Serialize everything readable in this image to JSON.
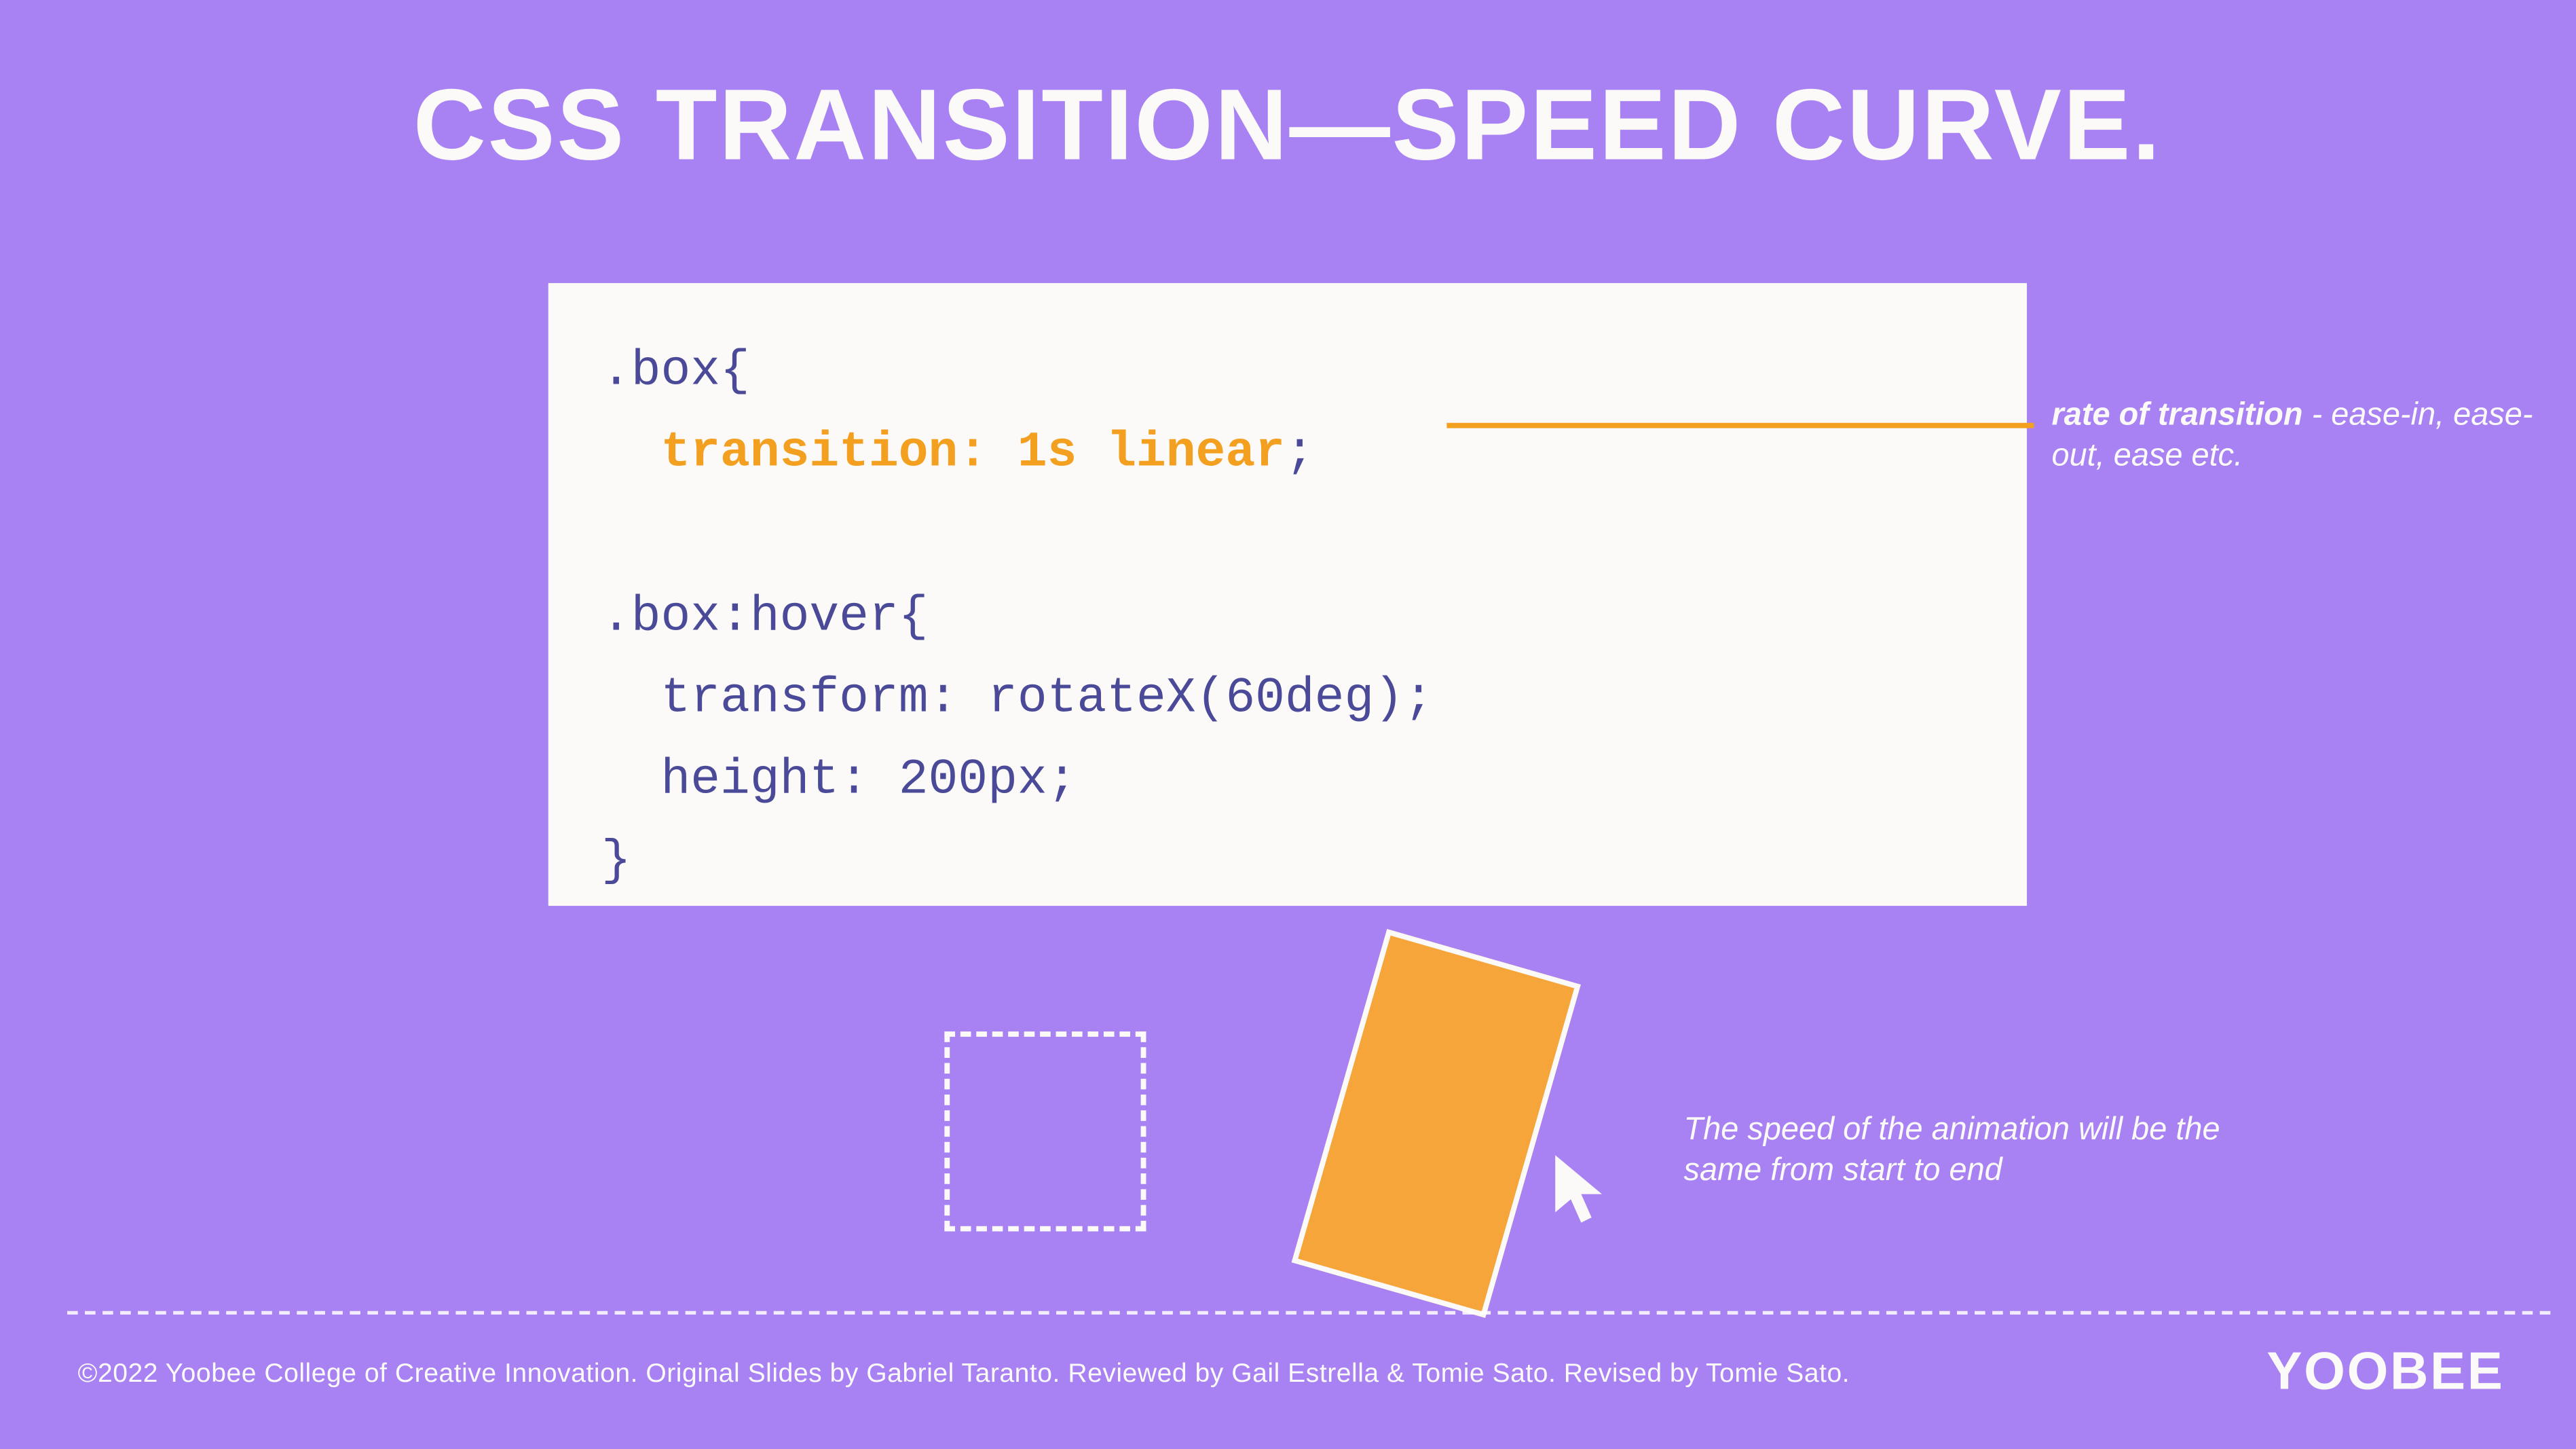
{
  "title": "CSS TRANSITION—SPEED CURVE.",
  "code": {
    "line1a": ".box{",
    "line2_indent": "  ",
    "line2_highlight": "transition: 1s linear",
    "line2_suffix": ";",
    "line3": "",
    "line4": ".box:hover{",
    "line5": "  transform: rotateX(60deg);",
    "line6": "  height: 200px;",
    "line7": "}"
  },
  "annotation": {
    "bold": "rate of transition",
    "rest": " - ease-in, ease-out, ease etc."
  },
  "caption": "The speed of the animation will  be the same from start to end",
  "footer": "©2022 Yoobee College of Creative Innovation.  Original Slides by Gabriel Taranto.  Reviewed by Gail Estrella & Tomie Sato.  Revised by Tomie Sato.",
  "logo": "YOOBEE"
}
